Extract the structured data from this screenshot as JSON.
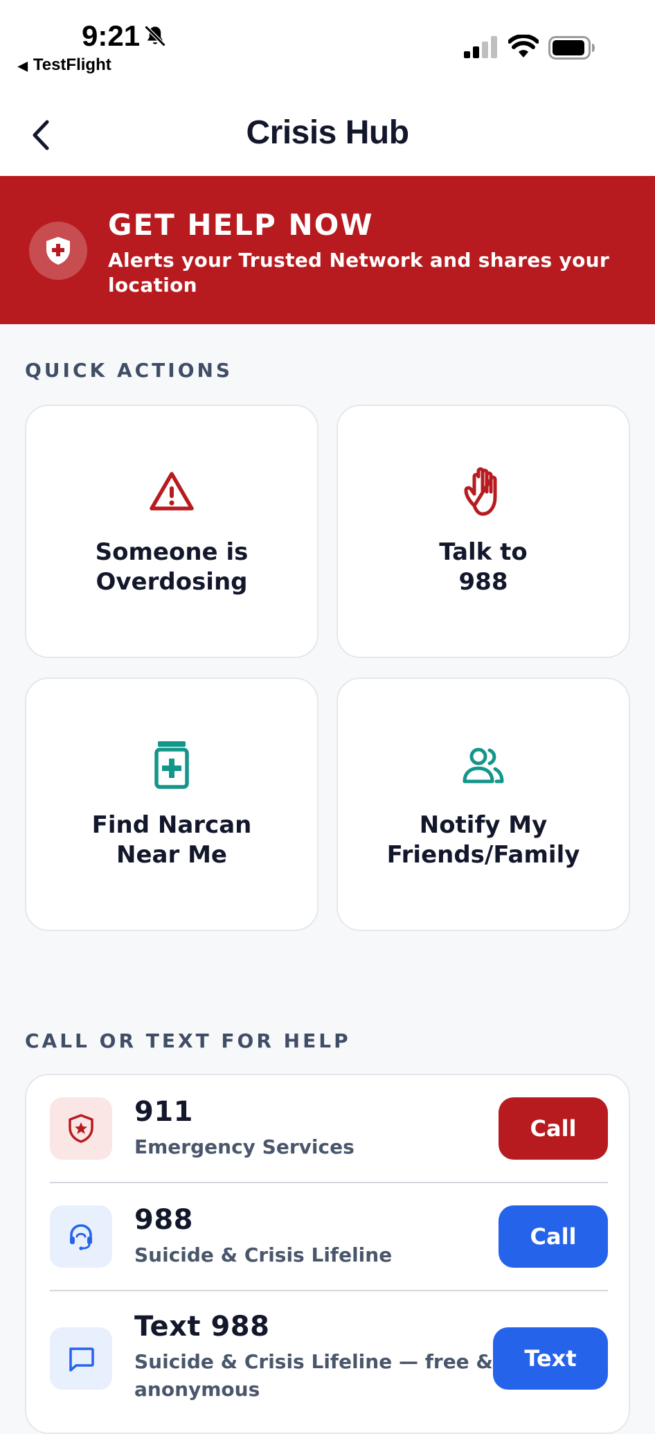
{
  "status_bar": {
    "time": "9:21",
    "back_app": "TestFlight"
  },
  "nav": {
    "title": "Crisis Hub"
  },
  "help_banner": {
    "title": "GET HELP NOW",
    "subtitle": "Alerts your Trusted Network and shares your location",
    "color": "#b81b1f"
  },
  "quick_actions": {
    "label": "QUICK ACTIONS",
    "items": [
      {
        "label": "Someone is\nOverdosing",
        "icon": "warning-triangle-icon",
        "color": "#b81b1f"
      },
      {
        "label": "Talk to\n988",
        "icon": "raised-hand-icon",
        "color": "#b81b1f"
      },
      {
        "label": "Find Narcan\nNear Me",
        "icon": "medicine-kit-icon",
        "color": "#13968a"
      },
      {
        "label": "Notify My\nFriends/Family",
        "icon": "people-icon",
        "color": "#13968a"
      }
    ]
  },
  "contacts": {
    "label": "CALL OR TEXT FOR HELP",
    "items": [
      {
        "title": "911",
        "subtitle": "Emergency Services",
        "button": "Call",
        "icon": "shield-star-icon",
        "button_color": "#b81b1f"
      },
      {
        "title": "988",
        "subtitle": "Suicide & Crisis Lifeline",
        "button": "Call",
        "icon": "headset-icon",
        "button_color": "#2563eb"
      },
      {
        "title": "Text 988",
        "subtitle": "Suicide & Crisis Lifeline — free & anonymous",
        "button": "Text",
        "icon": "chat-bubble-icon",
        "button_color": "#2563eb"
      }
    ]
  }
}
